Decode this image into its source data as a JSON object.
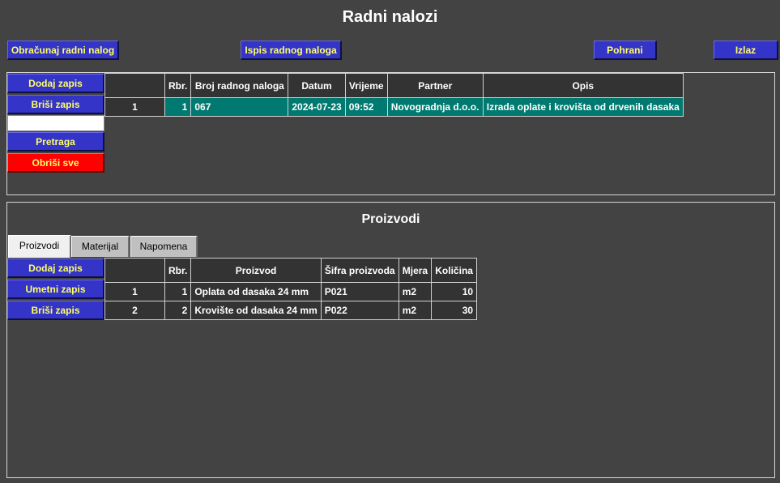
{
  "window": {
    "title": "Radni nalozi"
  },
  "toolbar": {
    "calculate_label": "Obračunaj radni nalog",
    "print_label": "Ispis radnog naloga",
    "save_label": "Pohrani",
    "exit_label": "Izlaz"
  },
  "orders": {
    "buttons": {
      "add": "Dodaj zapis",
      "delete": "Briši zapis",
      "search": "Pretraga",
      "clear_all": "Obriši sve"
    },
    "search_value": "",
    "columns": [
      "Rbr.",
      "Broj radnog naloga",
      "Datum",
      "Vrijeme",
      "Partner",
      "Opis"
    ],
    "rows": [
      {
        "index": "1",
        "rbr": "1",
        "broj": "067",
        "datum": "2024-07-23",
        "vrijeme": "09:52",
        "partner": "Novogradnja d.o.o.",
        "opis": "Izrada oplate i krovišta od drvenih dasaka"
      }
    ]
  },
  "products": {
    "title": "Proizvodi",
    "tabs": [
      "Proizvodi",
      "Materijal",
      "Napomena"
    ],
    "active_tab": "Proizvodi",
    "buttons": {
      "add": "Dodaj zapis",
      "insert": "Umetni zapis",
      "delete": "Briši zapis"
    },
    "columns": [
      "Rbr.",
      "Proizvod",
      "Šifra proizvoda",
      "Mjera",
      "Količina"
    ],
    "rows": [
      {
        "index": "1",
        "rbr": "1",
        "proizvod": "Oplata od dasaka 24 mm",
        "sifra": "P021",
        "mjera": "m2",
        "kolicina": "10"
      },
      {
        "index": "2",
        "rbr": "2",
        "proizvod": "Krovište od dasaka 24 mm",
        "sifra": "P022",
        "mjera": "m2",
        "kolicina": "30"
      }
    ]
  },
  "colors": {
    "background": "#434343",
    "button": "#3434c8",
    "button_text": "#ffff66",
    "danger_button": "#ff0000",
    "selected_row": "#007a70"
  }
}
